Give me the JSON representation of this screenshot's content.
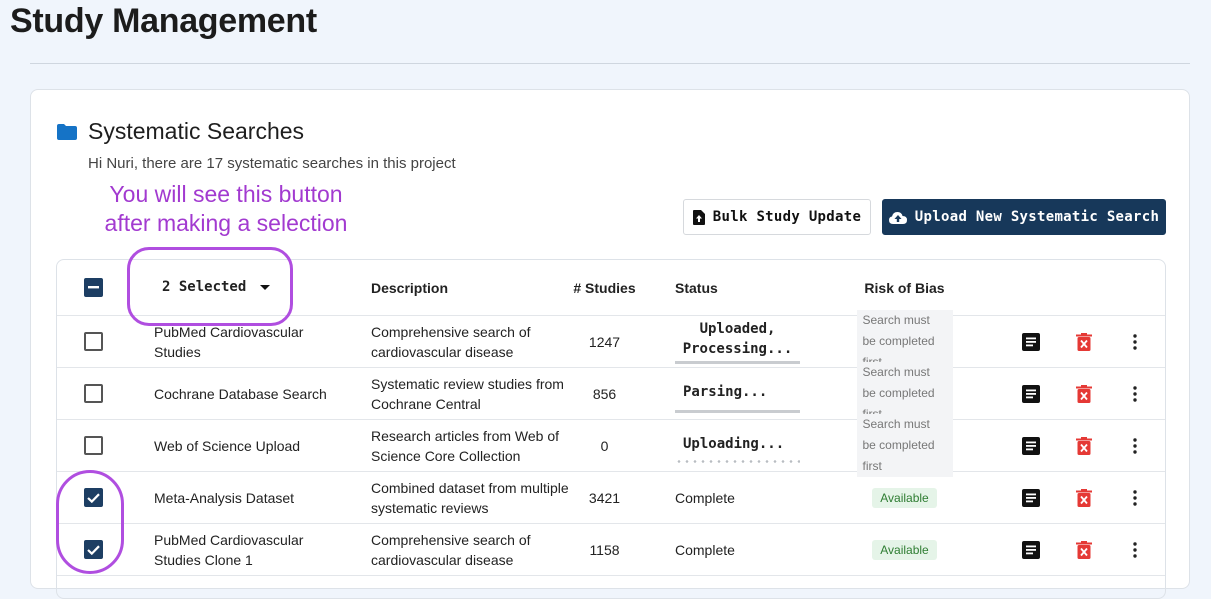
{
  "page": {
    "title": "Study Management"
  },
  "card": {
    "title": "Systematic Searches",
    "subtitle": "Hi Nuri, there are 17 systematic searches in this project"
  },
  "annotation": {
    "line1": "You will see this button",
    "line2": "after making a selection"
  },
  "toolbar": {
    "bulk_label": "Bulk Study Update",
    "upload_label": "Upload New Systematic Search"
  },
  "table": {
    "selected_label": "2 Selected",
    "headers": {
      "description": "Description",
      "studies": "# Studies",
      "status": "Status",
      "rob": "Risk of Bias"
    },
    "rows": [
      {
        "name": "PubMed Cardiovascular Studies",
        "description": "Comprehensive search of cardiovascular disease",
        "studies": "1247",
        "status": "Uploaded, Processing...",
        "rob": "Search must be completed first",
        "checked": false
      },
      {
        "name": "Cochrane Database Search",
        "description": "Systematic review studies from Cochrane Central",
        "studies": "856",
        "status": "Parsing...",
        "rob": "Search must be completed first",
        "checked": false
      },
      {
        "name": "Web of Science Upload",
        "description": "Research articles from Web of Science Core Collection",
        "studies": "0",
        "status": "Uploading...",
        "rob": "Search must be completed first",
        "checked": false
      },
      {
        "name": "Meta-Analysis Dataset",
        "description": "Combined dataset from multiple systematic reviews",
        "studies": "3421",
        "status": "Complete",
        "rob": "Available",
        "checked": true
      },
      {
        "name": "PubMed Cardiovascular Studies Clone 1",
        "description": "Comprehensive search of cardiovascular disease",
        "studies": "1158",
        "status": "Complete",
        "rob": "Available",
        "checked": true
      }
    ]
  },
  "icons": {
    "folder": "folder-icon",
    "file_upload": "file-upload-icon",
    "cloud_upload": "cloud-upload-icon",
    "doc": "document-icon",
    "delete": "delete-icon",
    "more": "more-vert-icon"
  },
  "colors": {
    "brand": "#17385a",
    "accent_annotation": "#b04ee0",
    "danger": "#e53935",
    "success": "#2e7d32"
  }
}
